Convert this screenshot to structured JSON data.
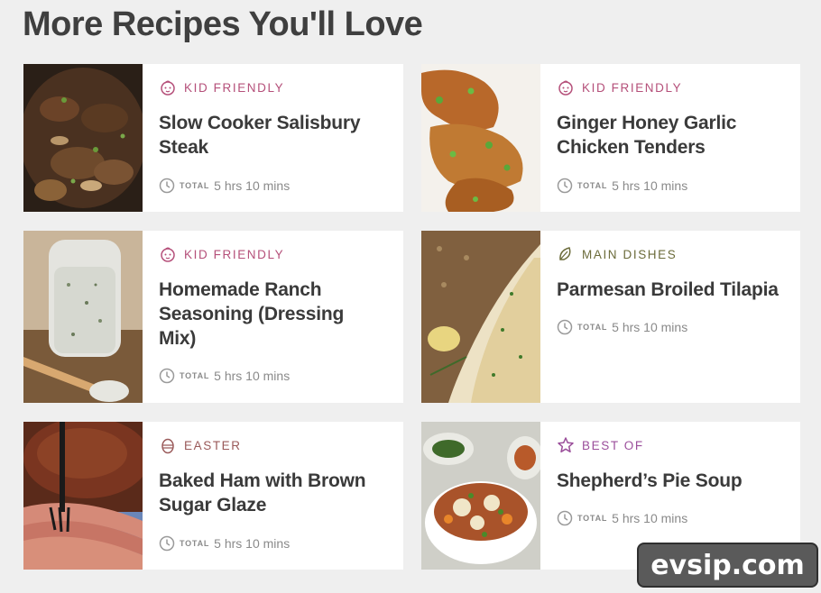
{
  "heading": "More Recipes You'll Love",
  "colors": {
    "kid_friendly": "#b5507a",
    "main_dishes": "#6b6b3a",
    "easter": "#9a5a5a",
    "best_of": "#9b4f9b"
  },
  "time_label": "TOTAL",
  "cards": [
    {
      "category": "KID FRIENDLY",
      "category_icon": "baby-face-icon",
      "title_line1": "Slow Cooker Salisbury",
      "title_line2": "Steak",
      "title_line3": "",
      "time": "5 hrs 10 mins"
    },
    {
      "category": "KID FRIENDLY",
      "category_icon": "baby-face-icon",
      "title_line1": "Ginger Honey Garlic",
      "title_line2": "Chicken Tenders",
      "title_line3": "",
      "time": "5 hrs 10 mins"
    },
    {
      "category": "KID FRIENDLY",
      "category_icon": "baby-face-icon",
      "title_line1": "Homemade Ranch",
      "title_line2": "Seasoning (Dressing",
      "title_line3": "Mix)",
      "time": "5 hrs 10 mins"
    },
    {
      "category": "MAIN DISHES",
      "category_icon": "leaf-icon",
      "title_line1": "Parmesan Broiled Tilapia",
      "title_line2": "",
      "title_line3": "",
      "time": "5 hrs 10 mins"
    },
    {
      "category": "EASTER",
      "category_icon": "egg-icon",
      "title_line1": "Baked Ham with Brown",
      "title_line2": "Sugar Glaze",
      "title_line3": "",
      "time": "5 hrs 10 mins"
    },
    {
      "category": "BEST OF",
      "category_icon": "star-icon",
      "title_line1": "Shepherd’s Pie Soup",
      "title_line2": "",
      "title_line3": "",
      "time": "5 hrs 10 mins"
    }
  ],
  "watermark": "evsip.com"
}
